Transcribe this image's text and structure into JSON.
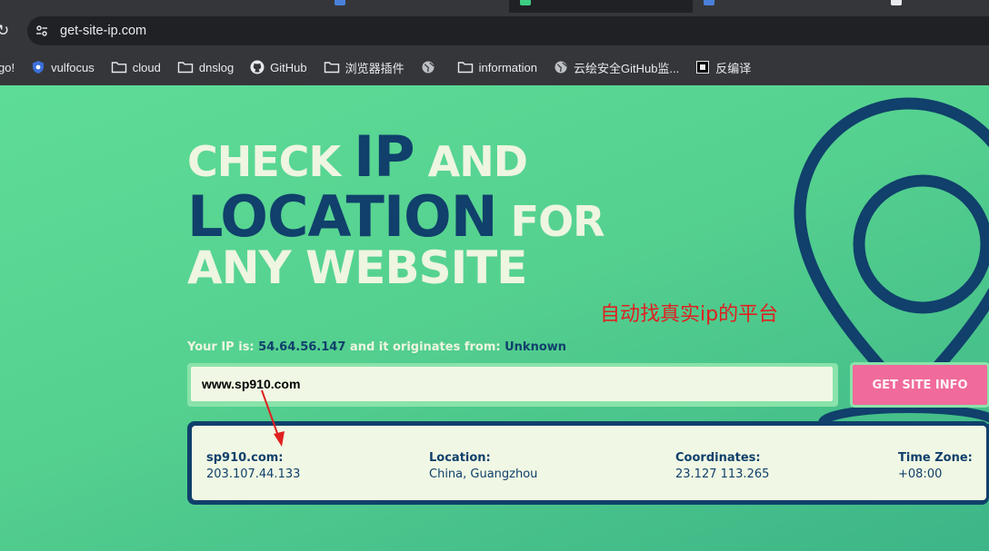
{
  "browser": {
    "address_bar": {
      "url": "get-site-ip.com"
    },
    "bookmarks": [
      {
        "label": "go!",
        "icon": "none"
      },
      {
        "label": "vulfocus",
        "icon": "shield-icon"
      },
      {
        "label": "cloud",
        "icon": "folder-icon"
      },
      {
        "label": "dnslog",
        "icon": "folder-icon"
      },
      {
        "label": "GitHub",
        "icon": "github-icon"
      },
      {
        "label": "浏览器插件",
        "icon": "folder-icon"
      },
      {
        "label": "",
        "icon": "globe-icon"
      },
      {
        "label": "information",
        "icon": "folder-icon"
      },
      {
        "label": "云绘安全GitHub监...",
        "icon": "globe-icon"
      },
      {
        "label": "反编译",
        "icon": "app-icon"
      }
    ]
  },
  "hero": {
    "line1": {
      "part1": "CHECK ",
      "highlight": "IP",
      "part2": " AND"
    },
    "line2": {
      "highlight": "LOCATION",
      "part2": " FOR"
    },
    "line3": "ANY WEBSITE"
  },
  "annotation": "自动找真实ip的平台",
  "your_ip": {
    "prefix": "Your IP is: ",
    "ip": "54.64.56.147",
    "middle": " and it originates from: ",
    "origin": "Unknown"
  },
  "search": {
    "value": "www.sp910.com",
    "button_label": "GET SITE INFO"
  },
  "result": {
    "site_label": "sp910.com:",
    "site_ip": "203.107.44.133",
    "location_label": "Location:",
    "location_value": "China, Guangzhou",
    "coords_label": "Coordinates:",
    "coords_value": "23.127 113.265",
    "tz_label": "Time Zone:",
    "tz_value": "+08:00"
  },
  "colors": {
    "navy": "#10406b",
    "cream": "#eef5e1",
    "green": "#5ddc97",
    "pink": "#f06a9c",
    "annotation_red": "#e02020"
  }
}
